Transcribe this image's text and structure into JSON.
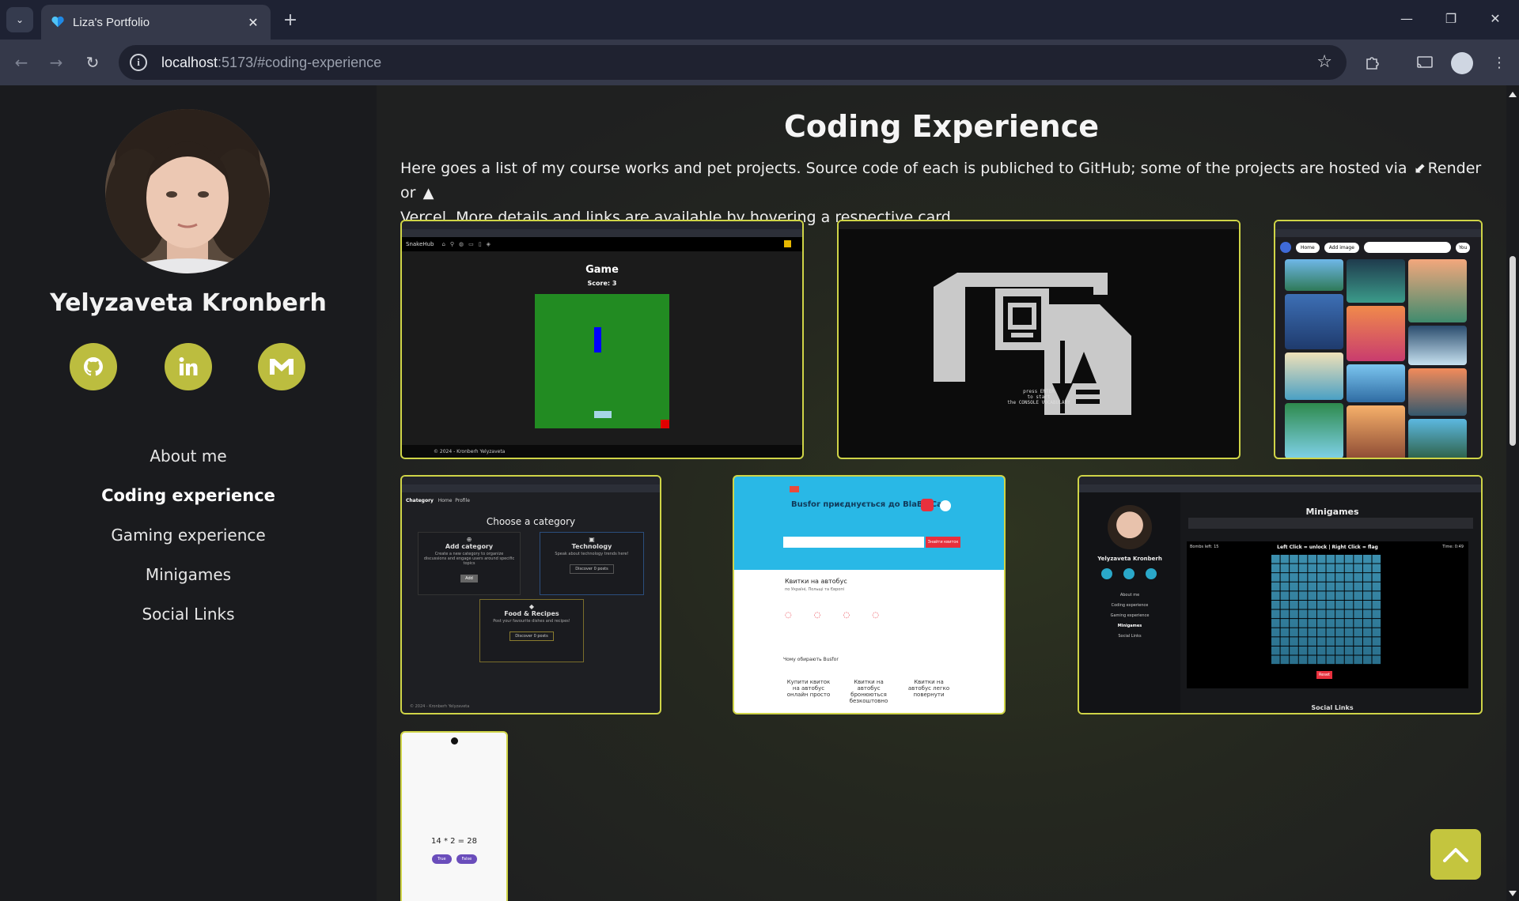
{
  "browser": {
    "tab_title": "Liza's Portfolio",
    "url_host": "localhost",
    "url_rest": ":5173/#coding-experience"
  },
  "profile": {
    "name": "Yelyzaveta Kronberh"
  },
  "nav": {
    "items": [
      {
        "label": "About me"
      },
      {
        "label": "Coding experience"
      },
      {
        "label": "Gaming experience"
      },
      {
        "label": "Minigames"
      },
      {
        "label": "Social Links"
      }
    ]
  },
  "section": {
    "title": "Coding Experience",
    "intro_part1": "Here goes a list of my course works and pet projects. Source code of each is publiched to GitHub; some of the projects are hosted via ",
    "render_label": "Render",
    "intro_or": " or ",
    "intro_part2": "Vercel. More details and links are available by hovering a respective card."
  },
  "cards": {
    "snake": {
      "app_name": "SnakeHub",
      "game_title": "Game",
      "score": "Score: 3",
      "footer": "© 2024 - Kronberh Yelyzaveta"
    },
    "vocab": {
      "line1": "press ENTER",
      "line2": "to start",
      "line3": "the CONSOLE VOCABULARY"
    },
    "gallery": {
      "home": "Home",
      "add_image": "Add image",
      "you": "You"
    },
    "forum": {
      "tabs": [
        "Chategory",
        "Home",
        "Profile"
      ],
      "title": "Choose a category",
      "cats": [
        {
          "name": "Add category",
          "desc": "Create a new category to organize discussions and engage users around specific topics",
          "btn": "Add"
        },
        {
          "name": "Technology",
          "desc": "Speak about technology trends here!",
          "btn": "Discover 0 posts"
        },
        {
          "name": "Food & Recipes",
          "desc": "Post your favourite dishes and recipes!",
          "btn": "Discover 0 posts"
        }
      ],
      "footer": "© 2024 - Kronberh Yelyzaveta"
    },
    "bus": {
      "headline": "Busfor приєднується до BlaBlaCar",
      "sub": "Квитки на автобус",
      "sub2": "по Україні, Польщі та Європі",
      "why": "Чому обирають Busfor",
      "btn": "Знайти квиток",
      "features": [
        "Купити квиток на автобус онлайн просто",
        "Квитки на автобус бронюються безкоштовно",
        "Квитки на автобус легко повернути"
      ]
    },
    "minigames": {
      "title": "Minigames",
      "name": "Yelyzaveta Kronberh",
      "nav": [
        "About me",
        "Coding experience",
        "Gaming experience",
        "Minigames",
        "Social Links"
      ],
      "board_title": "Left Click = unlock | Right Click = flag",
      "bombs": "Bombs left: 15",
      "time": "Time: 0:49",
      "reset": "Reset",
      "footer_heading": "Social Links"
    },
    "math": {
      "equation": "14 * 2 = 28",
      "true_label": "True",
      "false_label": "False"
    }
  },
  "colors": {
    "accent": "#bcbd3f",
    "card_border": "#cfd447",
    "sidebar_bg": "#1a1b1e"
  }
}
